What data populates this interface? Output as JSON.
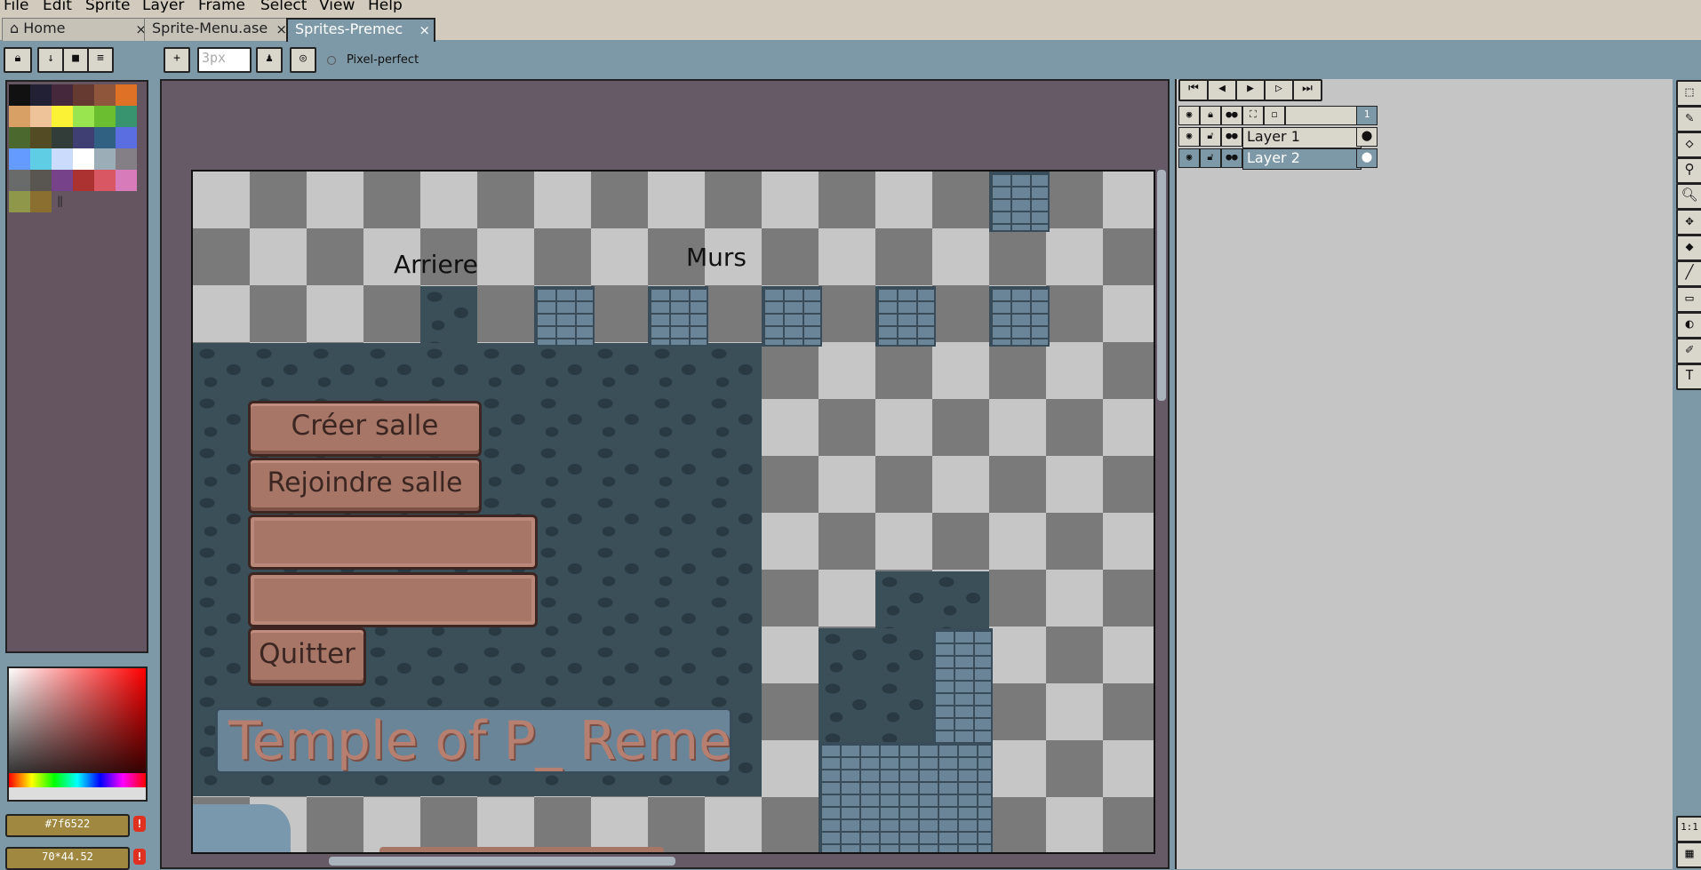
{
  "menu": [
    "File",
    "Edit",
    "Sprite",
    "Layer",
    "Frame",
    "Select",
    "View",
    "Help"
  ],
  "tabs": [
    {
      "label": "Home",
      "icon": "home-icon",
      "close": "×"
    },
    {
      "label": "Sprite-Menu.ase",
      "close": "×"
    },
    {
      "label": "Sprites-Premec",
      "close": "×"
    }
  ],
  "toolbar": {
    "brush_size_placeholder": "3px",
    "pixel_perfect_label": "Pixel-perfect",
    "add_label": "+"
  },
  "palette": {
    "colors": [
      "#111111",
      "#222034",
      "#45283c",
      "#663931",
      "#8f563b",
      "#df7126",
      "#d9a066",
      "#eec39a",
      "#fbf236",
      "#99e550",
      "#6abe30",
      "#37946e",
      "#4b692f",
      "#524b24",
      "#323c39",
      "#3f3f74",
      "#306082",
      "#5b6ee1",
      "#639bff",
      "#5fcde4",
      "#cbdbfc",
      "#ffffff",
      "#9badb7",
      "#847e87",
      "#696a6a",
      "#595652",
      "#76428a",
      "#ac3232",
      "#d95763",
      "#d77bba",
      "#8f974a",
      "#8a6f30"
    ]
  },
  "status": {
    "color_hex": "#7f6522",
    "coords": "70*44.52",
    "warn_icon": "!"
  },
  "sprite": {
    "label_back": "Arriere",
    "label_walls": "Murs",
    "btn_create": "Créer salle",
    "btn_join": "Rejoindre salle",
    "btn_quit": "Quitter",
    "title_text": "Temple of P_ Remed"
  },
  "timeline": {
    "frame_number": "1",
    "layers": [
      {
        "name": "Layer 1",
        "selected": false
      },
      {
        "name": "Layer 2",
        "selected": true
      }
    ]
  },
  "zoom_label": "1:1"
}
